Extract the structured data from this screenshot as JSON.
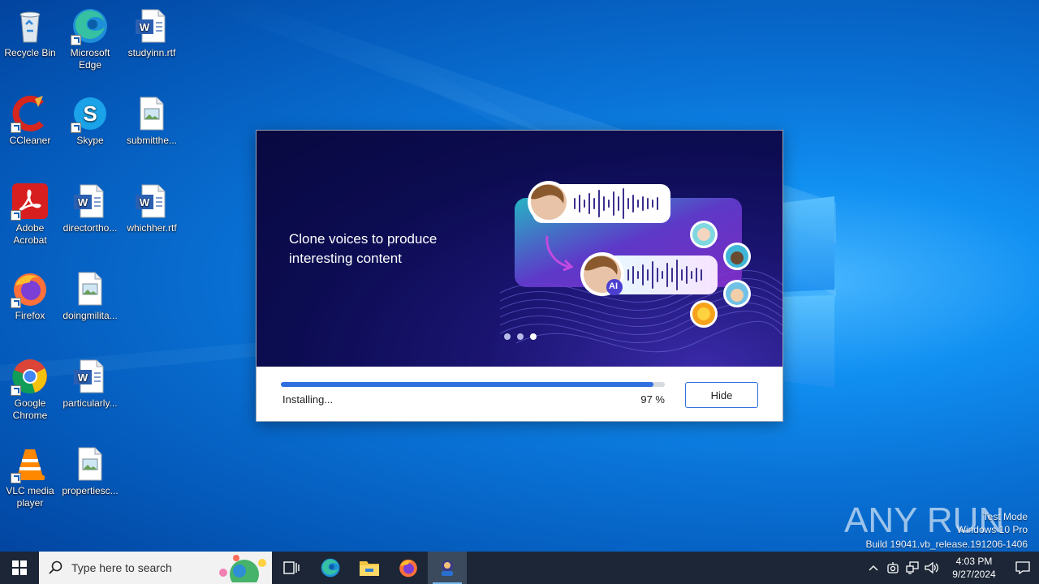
{
  "desktop": {
    "icons": [
      {
        "label": "Recycle Bin"
      },
      {
        "label": "Microsoft Edge"
      },
      {
        "label": "studyinn.rtf"
      },
      {
        "label": "CCleaner"
      },
      {
        "label": "Skype"
      },
      {
        "label": "submitthe..."
      },
      {
        "label": "Adobe Acrobat"
      },
      {
        "label": "directortho..."
      },
      {
        "label": "whichher.rtf"
      },
      {
        "label": "Firefox"
      },
      {
        "label": "doingmilita..."
      },
      {
        "label": "Google Chrome"
      },
      {
        "label": "particularly..."
      },
      {
        "label": "VLC media player"
      },
      {
        "label": "propertiesc..."
      }
    ]
  },
  "installer": {
    "headline": "Clone voices to produce interesting content",
    "ai_badge": "AI",
    "slides_total": 3,
    "slide_active": 3,
    "status": "Installing...",
    "progress_percent": 97,
    "percent_label": "97 %",
    "hide_button": "Hide"
  },
  "watermark": {
    "logo": "ANY RUN",
    "line1": "Test Mode",
    "line2": "Windows 10 Pro",
    "line3": "Build 19041.vb_release.191206-1406"
  },
  "taskbar": {
    "search_placeholder": "Type here to search",
    "apps": [
      "task-view",
      "edge",
      "file-explorer",
      "firefox",
      "installer"
    ],
    "clock_time": "4:03 PM",
    "clock_date": "9/27/2024"
  },
  "colors": {
    "accent": "#2f6fe0",
    "taskbar": "#1c2636",
    "banner_bg": "#0c0c52"
  }
}
